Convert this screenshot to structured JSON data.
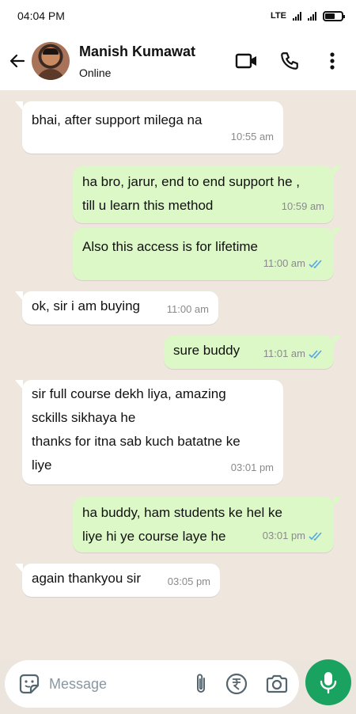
{
  "status_bar": {
    "time": "04:04 PM",
    "network": "LTE"
  },
  "header": {
    "contact_name": "Manish Kumawat",
    "contact_status": "Online",
    "icons": [
      "back-arrow-icon",
      "video-call-icon",
      "voice-call-icon",
      "more-options-icon"
    ]
  },
  "messages": [
    {
      "direction": "in",
      "text": "bhai, after support milega na",
      "time": "10:55 am"
    },
    {
      "direction": "out",
      "text": "ha bro, jarur, end to end support he ,\ntill u learn this method",
      "time": "10:59 am"
    },
    {
      "direction": "out",
      "text": "Also this access is for lifetime",
      "time": "11:00 am",
      "read": true
    },
    {
      "direction": "in",
      "text": "ok, sir i am buying",
      "time": "11:00 am"
    },
    {
      "direction": "out",
      "text": "sure buddy",
      "time": "11:01 am",
      "read": true
    },
    {
      "direction": "in",
      "text": "sir full course dekh liya, amazing\nsckills sikhaya he\nthanks for itna sab kuch batatne ke\nliye",
      "time": "03:01 pm"
    },
    {
      "direction": "out",
      "text": "ha buddy, ham students ke hel ke\nliye hi ye course laye he",
      "time": "03:01 pm",
      "read": true
    },
    {
      "direction": "in",
      "text": "again thankyou sir",
      "time": "03:05 pm"
    }
  ],
  "composer": {
    "placeholder": "Message",
    "icons": [
      "sticker-icon",
      "attach-icon",
      "rupee-payment-icon",
      "camera-icon",
      "mic-icon"
    ]
  },
  "colors": {
    "incoming_bubble": "#ffffff",
    "outgoing_bubble": "#dcf8c6",
    "chat_background": "#efe7de",
    "read_ticks": "#53a6e6",
    "mic_button": "#1aa260"
  }
}
